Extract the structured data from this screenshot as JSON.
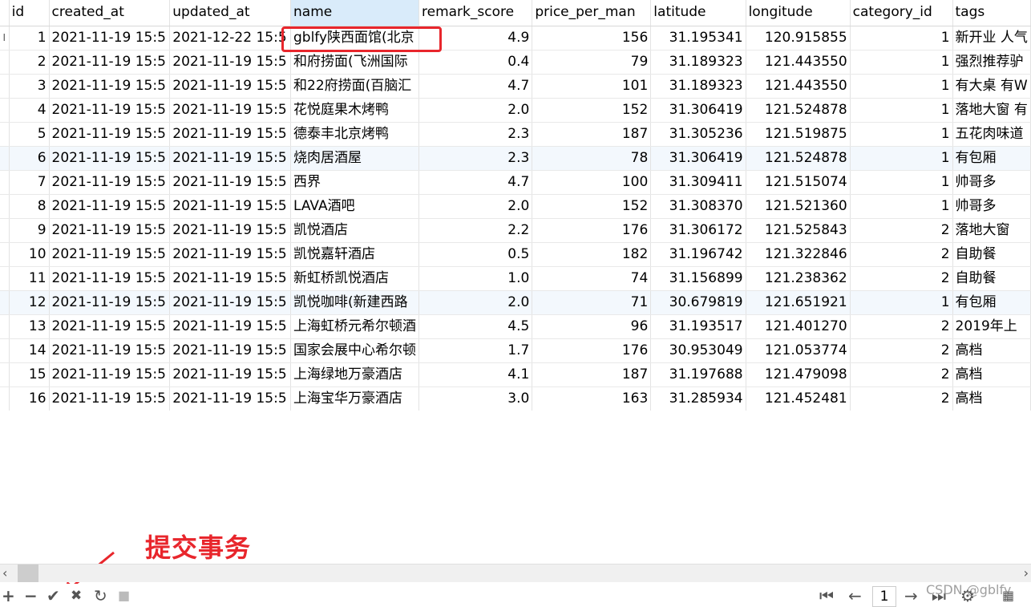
{
  "columns": [
    "id",
    "created_at",
    "updated_at",
    "name",
    "remark_score",
    "price_per_man",
    "latitude",
    "longitude",
    "category_id",
    "tags"
  ],
  "rows": [
    [
      "1",
      "2021-11-19 15:5",
      "2021-12-22 15:5",
      "gblfy陕西面馆(北京",
      "4.9",
      "156",
      "31.195341",
      "120.915855",
      "1",
      "新开业 人气"
    ],
    [
      "2",
      "2021-11-19 15:5",
      "2021-11-19 15:5",
      "和府捞面(飞洲国际",
      "0.4",
      "79",
      "31.189323",
      "121.443550",
      "1",
      "强烈推荐驴"
    ],
    [
      "3",
      "2021-11-19 15:5",
      "2021-11-19 15:5",
      "和22府捞面(百脑汇",
      "4.7",
      "101",
      "31.189323",
      "121.443550",
      "1",
      "有大桌 有W"
    ],
    [
      "4",
      "2021-11-19 15:5",
      "2021-11-19 15:5",
      "花悦庭果木烤鸭",
      "2.0",
      "152",
      "31.306419",
      "121.524878",
      "1",
      "落地大窗 有"
    ],
    [
      "5",
      "2021-11-19 15:5",
      "2021-11-19 15:5",
      "德泰丰北京烤鸭",
      "2.3",
      "187",
      "31.305236",
      "121.519875",
      "1",
      "五花肉味道"
    ],
    [
      "6",
      "2021-11-19 15:5",
      "2021-11-19 15:5",
      "烧肉居酒屋",
      "2.3",
      "78",
      "31.306419",
      "121.524878",
      "1",
      "有包厢"
    ],
    [
      "7",
      "2021-11-19 15:5",
      "2021-11-19 15:5",
      "西界",
      "4.7",
      "100",
      "31.309411",
      "121.515074",
      "1",
      "帅哥多"
    ],
    [
      "8",
      "2021-11-19 15:5",
      "2021-11-19 15:5",
      "LAVA酒吧",
      "2.0",
      "152",
      "31.308370",
      "121.521360",
      "1",
      "帅哥多"
    ],
    [
      "9",
      "2021-11-19 15:5",
      "2021-11-19 15:5",
      "凯悦酒店",
      "2.2",
      "176",
      "31.306172",
      "121.525843",
      "2",
      "落地大窗"
    ],
    [
      "10",
      "2021-11-19 15:5",
      "2021-11-19 15:5",
      "凯悦嘉轩酒店",
      "0.5",
      "182",
      "31.196742",
      "121.322846",
      "2",
      "自助餐"
    ],
    [
      "11",
      "2021-11-19 15:5",
      "2021-11-19 15:5",
      "新虹桥凯悦酒店",
      "1.0",
      "74",
      "31.156899",
      "121.238362",
      "2",
      "自助餐"
    ],
    [
      "12",
      "2021-11-19 15:5",
      "2021-11-19 15:5",
      "凯悦咖啡(新建西路",
      "2.0",
      "71",
      "30.679819",
      "121.651921",
      "1",
      "有包厢"
    ],
    [
      "13",
      "2021-11-19 15:5",
      "2021-11-19 15:5",
      "上海虹桥元希尔顿酒",
      "4.5",
      "96",
      "31.193517",
      "121.401270",
      "2",
      "2019年上"
    ],
    [
      "14",
      "2021-11-19 15:5",
      "2021-11-19 15:5",
      "国家会展中心希尔顿",
      "1.7",
      "176",
      "30.953049",
      "121.053774",
      "2",
      "高档"
    ],
    [
      "15",
      "2021-11-19 15:5",
      "2021-11-19 15:5",
      "上海绿地万豪酒店",
      "4.1",
      "187",
      "31.197688",
      "121.479098",
      "2",
      "高档"
    ],
    [
      "16",
      "2021-11-19 15:5",
      "2021-11-19 15:5",
      "上海宝华万豪酒店",
      "3.0",
      "163",
      "31.285934",
      "121.452481",
      "2",
      "高档"
    ]
  ],
  "annotation": {
    "text": "提交事务",
    "color": "#e8262c"
  },
  "toolbar": {
    "add": "+",
    "remove": "−",
    "commit": "✔",
    "discard": "✖",
    "refresh": "↻",
    "stop": "■",
    "first": "⏮",
    "prev": "←",
    "page": "1",
    "next": "→",
    "last": "⏭",
    "settings": "⚙"
  },
  "scroll": {
    "left": "‹",
    "right": "›"
  },
  "watermark": "CSDN @gblfy",
  "row_marker": "I",
  "colors": {
    "selected_header": "#d9ebfa",
    "alt_row": "#f3f8fd",
    "highlight": "#e8262c"
  }
}
